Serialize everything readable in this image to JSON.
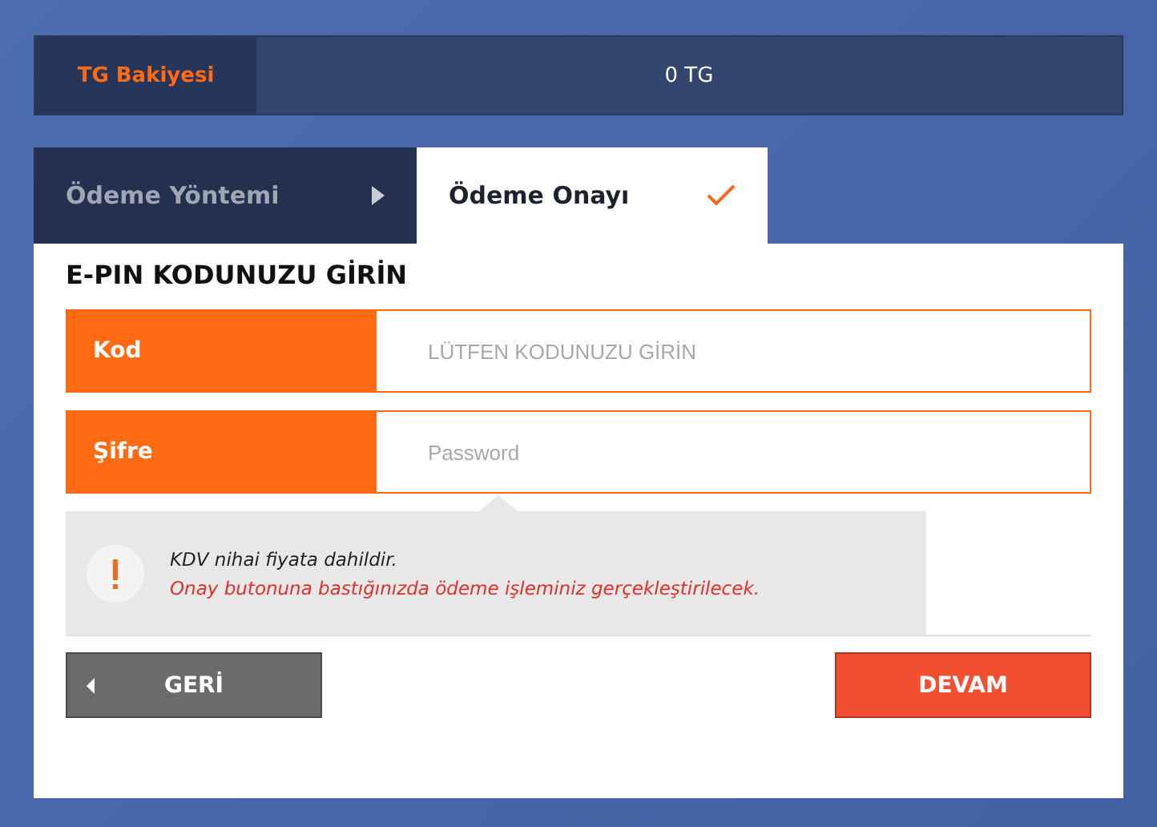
{
  "balance": {
    "label": "TG Bakiyesi",
    "value": "0 TG"
  },
  "tabs": [
    {
      "label": "Ödeme Yöntemi",
      "selected": false
    },
    {
      "label": "Ödeme Onayı",
      "selected": true
    }
  ],
  "form": {
    "title": "E-PIN KODUNUZU GİRİN",
    "fields": [
      {
        "label": "Kod",
        "placeholder": "LÜTFEN KODUNUZU GİRİN"
      },
      {
        "label": "Şifre",
        "placeholder": "Password"
      }
    ]
  },
  "notice": {
    "lines": [
      "KDV nihai fiyata dahildir.",
      "Onay butonuna bastığınızda ödeme işleminiz gerçekleştirilecek."
    ]
  },
  "buttons": [
    {
      "label": "GERİ",
      "kind": "back"
    },
    {
      "label": "DEVAM",
      "kind": "next"
    }
  ]
}
